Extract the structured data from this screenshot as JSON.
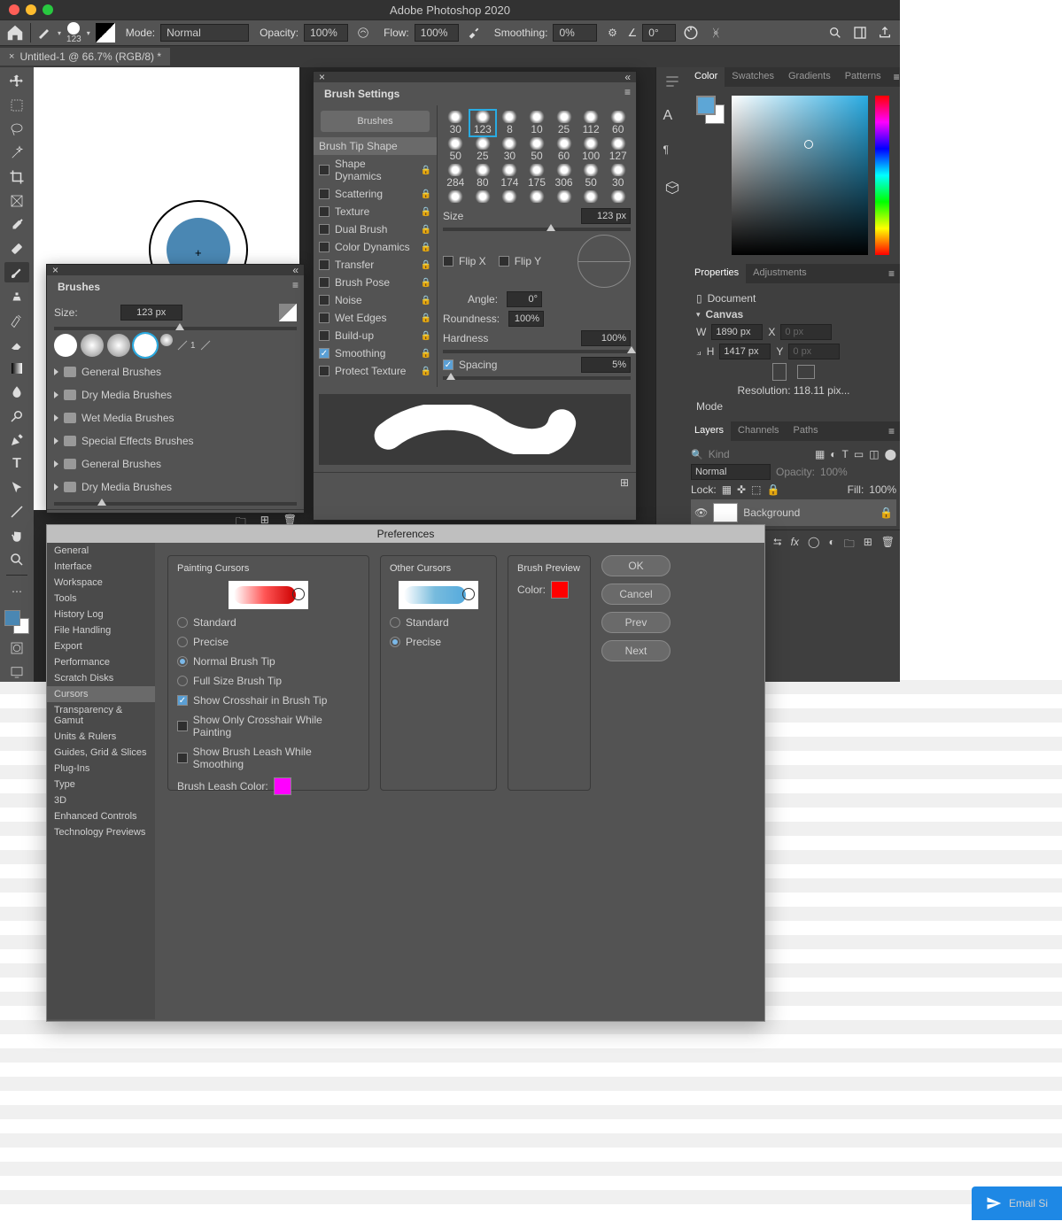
{
  "app_title": "Adobe Photoshop 2020",
  "document_tab": "Untitled-1 @ 66.7% (RGB/8) *",
  "options_bar": {
    "brush_size": "123",
    "mode_label": "Mode:",
    "mode_value": "Normal",
    "opacity_label": "Opacity:",
    "opacity_value": "100%",
    "flow_label": "Flow:",
    "flow_value": "100%",
    "smoothing_label": "Smoothing:",
    "smoothing_value": "0%",
    "angle_value": "0°"
  },
  "brushes_panel": {
    "title": "Brushes",
    "size_label": "Size:",
    "size_value": "123 px",
    "folders": [
      "General Brushes",
      "Dry Media Brushes",
      "Wet Media Brushes",
      "Special Effects Brushes",
      "General Brushes",
      "Dry Media Brushes"
    ]
  },
  "brush_settings": {
    "title": "Brush Settings",
    "brushes_btn": "Brushes",
    "tip_shape": "Brush Tip Shape",
    "options": [
      {
        "label": "Shape Dynamics",
        "on": false
      },
      {
        "label": "Scattering",
        "on": false
      },
      {
        "label": "Texture",
        "on": false
      },
      {
        "label": "Dual Brush",
        "on": false
      },
      {
        "label": "Color Dynamics",
        "on": false
      },
      {
        "label": "Transfer",
        "on": false
      },
      {
        "label": "Brush Pose",
        "on": false
      },
      {
        "label": "Noise",
        "on": false
      },
      {
        "label": "Wet Edges",
        "on": false
      },
      {
        "label": "Build-up",
        "on": false
      },
      {
        "label": "Smoothing",
        "on": true
      },
      {
        "label": "Protect Texture",
        "on": false
      }
    ],
    "grid_sizes": [
      [
        "30",
        "123",
        "8",
        "10",
        "25",
        "112",
        "60"
      ],
      [
        "50",
        "25",
        "30",
        "50",
        "60",
        "100",
        "127"
      ],
      [
        "284",
        "80",
        "174",
        "175",
        "306",
        "50",
        "30"
      ],
      [
        "",
        "",
        "",
        "",
        "",
        "",
        ""
      ]
    ],
    "size_label": "Size",
    "size_value": "123 px",
    "flipx": "Flip X",
    "flipy": "Flip Y",
    "angle_label": "Angle:",
    "angle_value": "0°",
    "roundness_label": "Roundness:",
    "roundness_value": "100%",
    "hardness_label": "Hardness",
    "hardness_value": "100%",
    "spacing_label": "Spacing",
    "spacing_value": "5%"
  },
  "color_panel": {
    "tabs": [
      "Color",
      "Swatches",
      "Gradients",
      "Patterns"
    ]
  },
  "properties_panel": {
    "tabs": [
      "Properties",
      "Adjustments"
    ],
    "doc_label": "Document",
    "canvas": "Canvas",
    "w": "W",
    "w_val": "1890 px",
    "x": "X",
    "x_val": "0 px",
    "h": "H",
    "h_val": "1417 px",
    "y": "Y",
    "y_val": "0 px",
    "res": "Resolution: 118.11 pix...",
    "mode": "Mode"
  },
  "layers_panel": {
    "tabs": [
      "Layers",
      "Channels",
      "Paths"
    ],
    "kind": "Kind",
    "blend": "Normal",
    "opacity_lbl": "Opacity:",
    "opacity_val": "100%",
    "lock": "Lock:",
    "fill_lbl": "Fill:",
    "fill_val": "100%",
    "bg_layer": "Background"
  },
  "preferences": {
    "title": "Preferences",
    "categories": [
      "General",
      "Interface",
      "Workspace",
      "Tools",
      "History Log",
      "File Handling",
      "Export",
      "Performance",
      "Scratch Disks",
      "Cursors",
      "Transparency & Gamut",
      "Units & Rulers",
      "Guides, Grid & Slices",
      "Plug-Ins",
      "Type",
      "3D",
      "Enhanced Controls",
      "Technology Previews"
    ],
    "selected_cat": "Cursors",
    "painting_title": "Painting Cursors",
    "painting_opts": [
      "Standard",
      "Precise",
      "Normal Brush Tip",
      "Full Size Brush Tip"
    ],
    "painting_sel": "Normal Brush Tip",
    "show_crosshair": "Show Crosshair in Brush Tip",
    "show_only_cross": "Show Only Crosshair While Painting",
    "show_leash": "Show Brush Leash While Smoothing",
    "leash_color_lbl": "Brush Leash Color:",
    "leash_color": "#ff00ff",
    "other_title": "Other Cursors",
    "other_opts": [
      "Standard",
      "Precise"
    ],
    "other_sel": "Precise",
    "preview_title": "Brush Preview",
    "color_lbl": "Color:",
    "preview_color": "#ff0000",
    "buttons": [
      "OK",
      "Cancel",
      "Prev",
      "Next"
    ]
  },
  "email_btn": "Email Si"
}
